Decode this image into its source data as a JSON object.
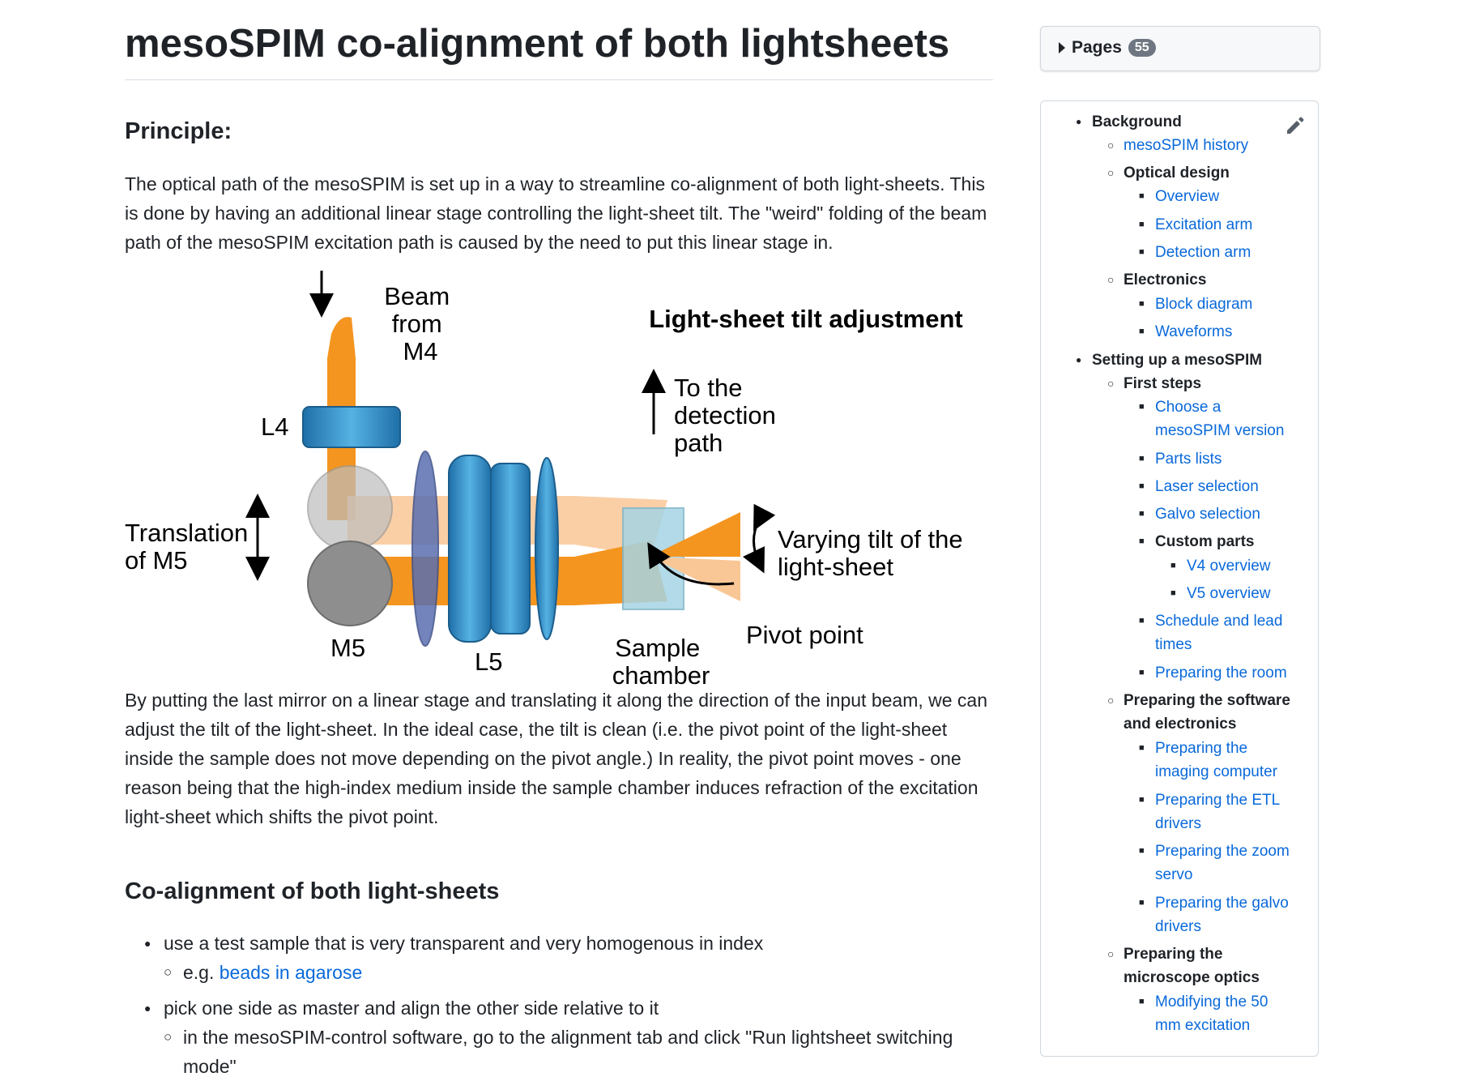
{
  "page": {
    "title": "mesoSPIM co-alignment of both lightsheets",
    "principle_heading": "Principle:",
    "intro": "The optical path of the mesoSPIM is set up in a way to streamline co-alignment of both light-sheets. This is done by having an additional linear stage controlling the light-sheet tilt. The \"weird\" folding of the beam path of the mesoSPIM excitation path is caused by the need to put this linear stage in.",
    "body_para": "By putting the last mirror on a linear stage and translating it along the direction of the input beam, we can adjust the tilt of the light-sheet. In the ideal case, the tilt is clean (i.e. the pivot point of the light-sheet inside the sample does not move depending on the pivot angle.) In reality, the pivot point moves - one reason being that the high-index medium inside the sample chamber induces refraction of the excitation light-sheet which shifts the pivot point.",
    "coalign_heading": "Co-alignment of both light-sheets",
    "steps": {
      "s1": "use a test sample that is very transparent and very homogenous in index",
      "s1_sub_prefix": "e.g. ",
      "s1_sub_link": "beads in agarose",
      "s2": "pick one side as master and align the other side relative to it",
      "s2_sub": "in the mesoSPIM-control software, go to the alignment tab and click \"Run lightsheet switching mode\""
    }
  },
  "figure": {
    "title": "Light-sheet tilt adjustment",
    "beam_line1": "Beam",
    "beam_line2": "from",
    "beam_line3": "M4",
    "l4": "L4",
    "translation_line1": "Translation",
    "translation_line2": "of M5",
    "m5": "M5",
    "l5": "L5",
    "detection_line1": "To the",
    "detection_line2": "detection",
    "detection_line3": "path",
    "tilt_line1": "Varying tilt of the",
    "tilt_line2": "light-sheet",
    "pivot": "Pivot point",
    "sample_line1": "Sample",
    "sample_line2": "chamber"
  },
  "sidebar": {
    "pages_label": "Pages",
    "pages_count": "55",
    "toc": {
      "background": "Background",
      "history": "mesoSPIM history",
      "optical_design": "Optical design",
      "overview": "Overview",
      "excitation_arm": "Excitation arm",
      "detection_arm": "Detection arm",
      "electronics": "Electronics",
      "block_diagram": "Block diagram",
      "waveforms": "Waveforms",
      "setting_up": "Setting up a mesoSPIM",
      "first_steps": "First steps",
      "choose_1": "Choose a",
      "choose_2": "mesoSPIM version",
      "parts_lists": "Parts lists",
      "laser_selection": "Laser selection",
      "galvo_selection": "Galvo selection",
      "custom_parts": "Custom parts",
      "v4_overview": "V4 overview",
      "v5_overview": "V5 overview",
      "schedule_1": "Schedule and lead",
      "schedule_2": "times",
      "prep_room": "Preparing the room",
      "prep_software_1": "Preparing the software",
      "prep_software_2": "and electronics",
      "prep_imaging_1": "Preparing the",
      "prep_imaging_2": "imaging computer",
      "prep_etl_1": "Preparing the ETL",
      "prep_etl_2": "drivers",
      "prep_zoom_1": "Preparing the zoom",
      "prep_zoom_2": "servo",
      "prep_galvo_1": "Preparing the galvo",
      "prep_galvo_2": "drivers",
      "prep_optics_1": "Preparing the",
      "prep_optics_2": "microscope optics",
      "modifying_1": "Modifying the 50",
      "modifying_2": "mm excitation"
    }
  },
  "colors": {
    "link": "#0969da",
    "text": "#1f2328",
    "beam_orange": "#f4951f",
    "lens_blue": "#2f8fc8",
    "mirror_gray": "#9a9a9a",
    "counter_bg": "#6e7781"
  }
}
